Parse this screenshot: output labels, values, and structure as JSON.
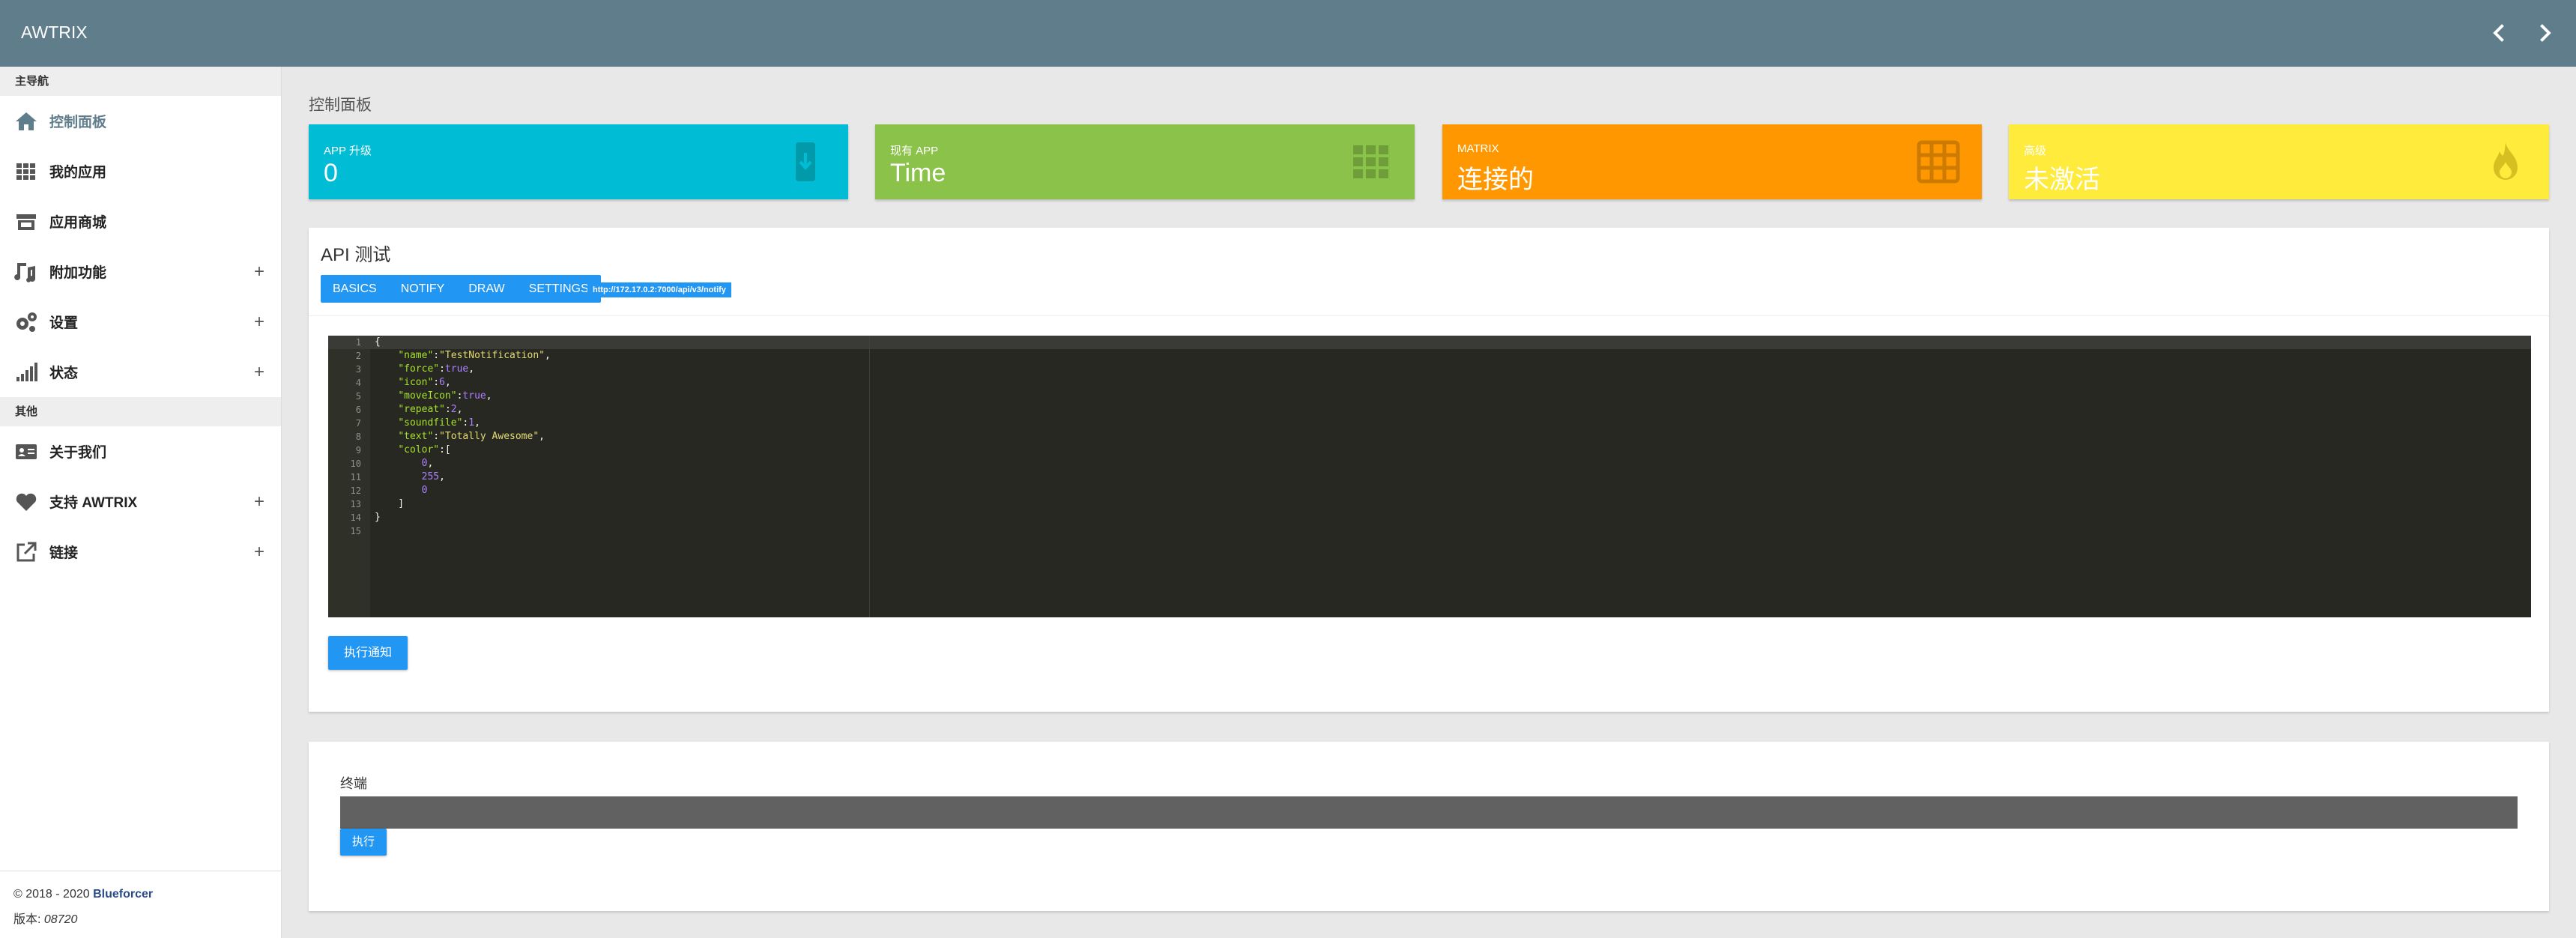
{
  "header": {
    "title": "AWTRIX"
  },
  "sidebar": {
    "section_main": "主导航",
    "section_other": "其他",
    "items_main": [
      {
        "label": "控制面板",
        "icon": "home-icon",
        "has_plus": false,
        "active": true
      },
      {
        "label": "我的应用",
        "icon": "grid-icon",
        "has_plus": false
      },
      {
        "label": "应用商城",
        "icon": "store-icon",
        "has_plus": false
      },
      {
        "label": "附加功能",
        "icon": "music-icon",
        "has_plus": true
      },
      {
        "label": "设置",
        "icon": "gears-icon",
        "has_plus": true
      },
      {
        "label": "状态",
        "icon": "signal-icon",
        "has_plus": true
      }
    ],
    "items_other": [
      {
        "label": "关于我们",
        "icon": "id-card-icon",
        "has_plus": false
      },
      {
        "label": "支持 AWTRIX",
        "icon": "heart-icon",
        "has_plus": true
      },
      {
        "label": "链接",
        "icon": "external-link-icon",
        "has_plus": true
      }
    ],
    "footer": {
      "copyright": "© 2018 - 2020",
      "brand": "Blueforcer",
      "version_label": "版本:",
      "version": "08720"
    }
  },
  "main": {
    "page_title": "控制面板",
    "stats": [
      {
        "label": "APP 升级",
        "value": "0",
        "color": "#00bcd4",
        "icon": "download-phone-icon"
      },
      {
        "label": "现有 APP",
        "value": "Time",
        "color": "#8bc34a",
        "icon": "apps-grid-icon"
      },
      {
        "label": "MATRIX",
        "value": "连接的",
        "color": "#ff9800",
        "icon": "matrix-grid-icon"
      },
      {
        "label": "高级",
        "value": "未激活",
        "color": "#ffeb3b",
        "icon": "flame-icon"
      }
    ],
    "api": {
      "title": "API 测试",
      "tabs": [
        "BASICS",
        "NOTIFY",
        "DRAW",
        "SETTINGS"
      ],
      "url": "http://172.17.0.2:7000/api/v3/notify",
      "execute_label": "执行通知",
      "code_lines": [
        "{",
        "    \"name\":\"TestNotification\",",
        "    \"force\":true,",
        "    \"icon\":6,",
        "    \"moveIcon\":true,",
        "    \"repeat\":2,",
        "    \"soundfile\":1,",
        "    \"text\":\"Totally Awesome\",",
        "    \"color\":[",
        "        0,",
        "        255,",
        "        0",
        "    ]",
        "}",
        ""
      ]
    },
    "terminal": {
      "label": "终端",
      "value": "",
      "execute_label": "执行"
    }
  }
}
